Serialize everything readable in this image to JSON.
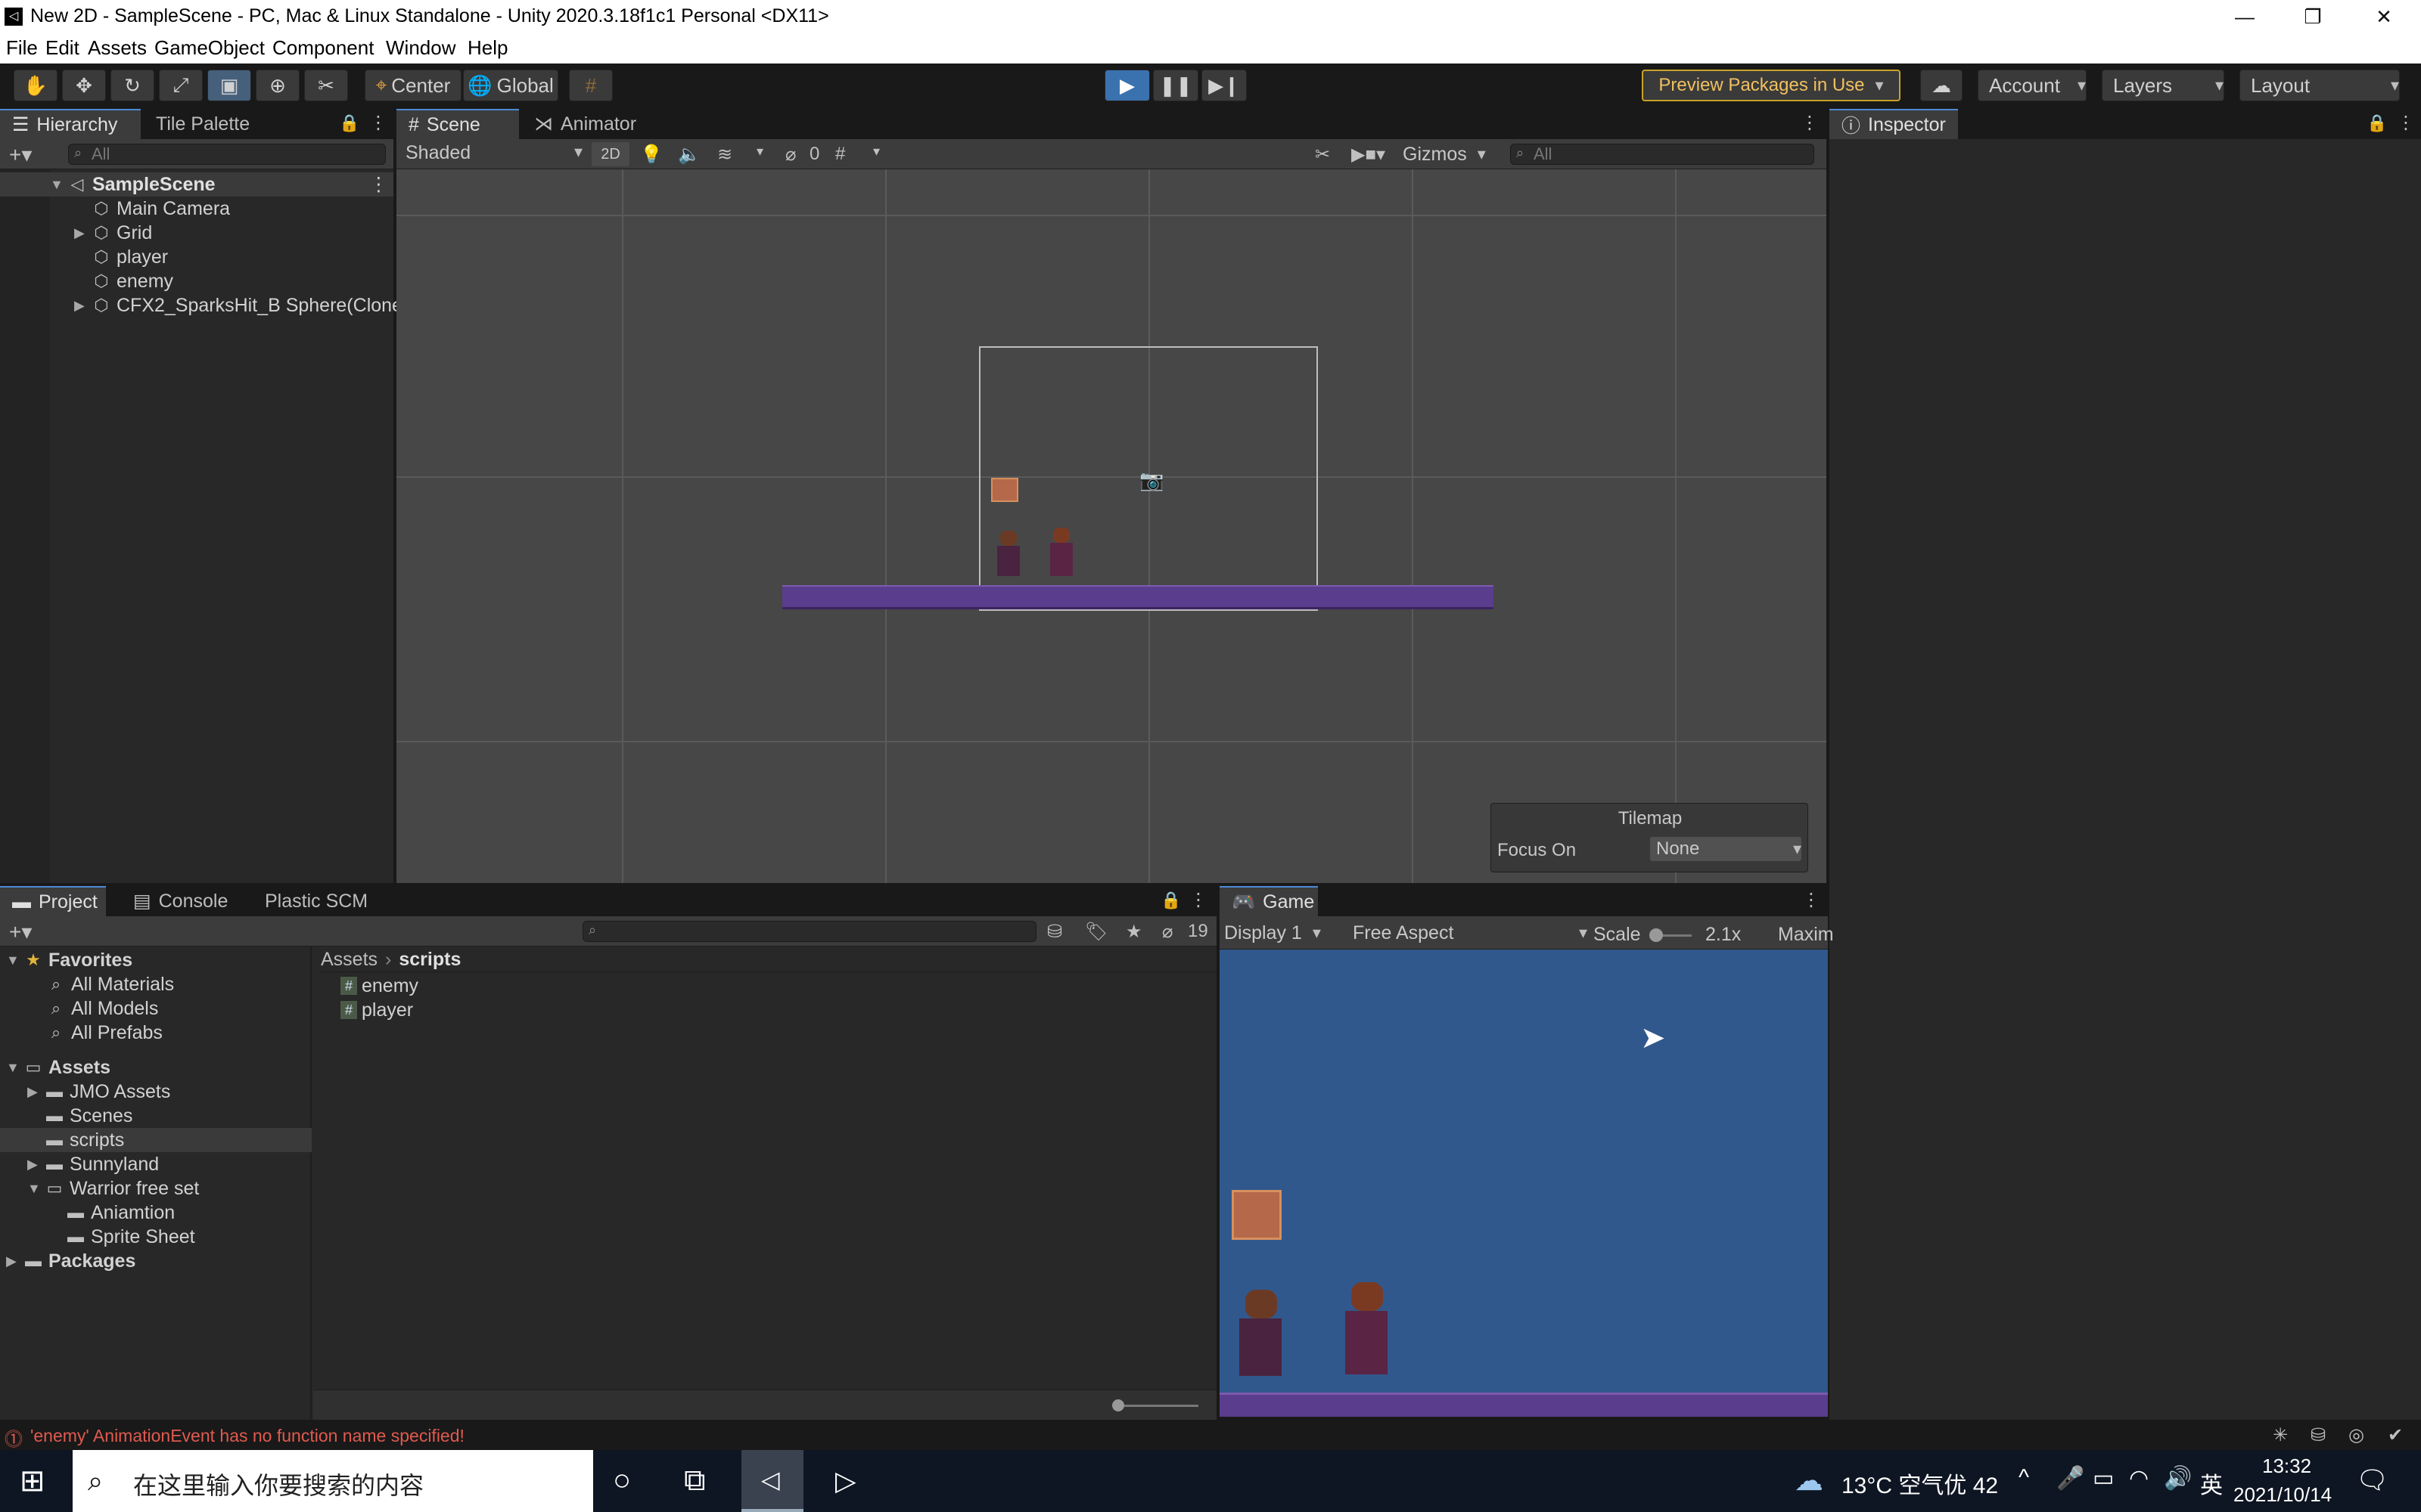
{
  "window": {
    "title": "New 2D - SampleScene - PC, Mac & Linux Standalone - Unity 2020.3.18f1c1 Personal <DX11>",
    "minimize": "—",
    "restore": "❐",
    "close": "✕"
  },
  "menu": [
    "File",
    "Edit",
    "Assets",
    "GameObject",
    "Component",
    "Window",
    "Help"
  ],
  "toolbar": {
    "tools": [
      "hand-tool",
      "move-tool",
      "rotate-tool",
      "scale-tool",
      "rect-tool",
      "transform-tool",
      "custom-tool"
    ],
    "pivot": "Center",
    "space": "Global",
    "preview_packages": "Preview Packages in Use",
    "account": "Account",
    "layers": "Layers",
    "layout": "Layout"
  },
  "hierarchy": {
    "tabs": [
      "Hierarchy",
      "Tile Palette"
    ],
    "search_placeholder": "All",
    "scene": "SampleScene",
    "items": [
      {
        "label": "Main Camera",
        "expandable": false
      },
      {
        "label": "Grid",
        "expandable": true
      },
      {
        "label": "player",
        "expandable": false
      },
      {
        "label": "enemy",
        "expandable": false
      },
      {
        "label": "CFX2_SparksHit_B Sphere(Clone",
        "expandable": true
      }
    ]
  },
  "scene": {
    "tabs": [
      "Scene",
      "Animator"
    ],
    "shading": "Shaded",
    "mode_2d": "2D",
    "hidden_count": "0",
    "gizmos": "Gizmos",
    "search_placeholder": "All",
    "tilemap_overlay": {
      "title": "Tilemap",
      "focus_label": "Focus On",
      "focus_value": "None"
    }
  },
  "inspector": {
    "tab": "Inspector"
  },
  "project": {
    "tabs": [
      "Project",
      "Console",
      "Plastic SCM"
    ],
    "hidden_count": "19",
    "favorites_label": "Favorites",
    "favorites": [
      "All Materials",
      "All Models",
      "All Prefabs"
    ],
    "assets_label": "Assets",
    "folders": [
      {
        "label": "JMO Assets",
        "depth": 1,
        "expandable": true
      },
      {
        "label": "Scenes",
        "depth": 1,
        "expandable": false
      },
      {
        "label": "scripts",
        "depth": 1,
        "expandable": false,
        "selected": true
      },
      {
        "label": "Sunnyland",
        "depth": 1,
        "expandable": true
      },
      {
        "label": "Warrior free set",
        "depth": 1,
        "expandable": true,
        "open": true
      },
      {
        "label": "Aniamtion",
        "depth": 2,
        "expandable": false
      },
      {
        "label": "Sprite Sheet",
        "depth": 2,
        "expandable": false
      }
    ],
    "packages_label": "Packages",
    "breadcrumb": [
      "Assets",
      "scripts"
    ],
    "files": [
      "enemy",
      "player"
    ]
  },
  "game": {
    "tab": "Game",
    "display": "Display 1",
    "aspect": "Free Aspect",
    "scale_label": "Scale",
    "scale_value": "2.1x",
    "maximize": "Maxim"
  },
  "status": {
    "message": "'enemy' AnimationEvent has no function name specified!"
  },
  "taskbar": {
    "search_placeholder": "在这里输入你要搜索的内容",
    "weather": "13°C 空气优 42",
    "ime": "英",
    "time": "13:32",
    "date": "2021/10/14"
  },
  "colors": {
    "accent": "#4d8ad6",
    "play_active": "#3a72b0",
    "preview_border": "#c9a227",
    "error": "#e05a4f",
    "game_bg": "#31588c"
  }
}
